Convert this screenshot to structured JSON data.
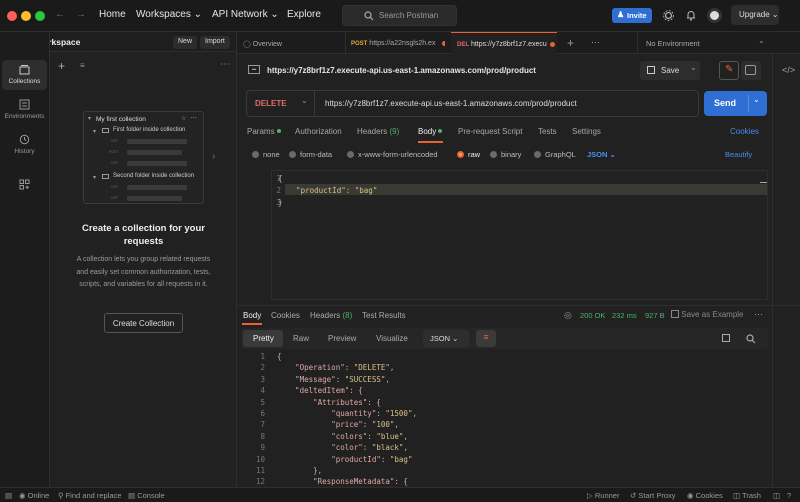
{
  "topbar": {
    "home": "Home",
    "workspaces": "Workspaces",
    "api_network": "API Network",
    "explore": "Explore",
    "search_placeholder": "Search Postman",
    "invite": "Invite",
    "upgrade": "Upgrade"
  },
  "workspace": {
    "name": "My Workspace",
    "new": "New",
    "import": "Import"
  },
  "rail": {
    "items": [
      "Collections",
      "Environments",
      "History"
    ]
  },
  "collections_empty": {
    "preview_title": "My first collection",
    "folder1": "First folder inside collection",
    "folder2": "Second folder inside collection",
    "methods": [
      "GET",
      "POST",
      "GET",
      "GET",
      "GET"
    ],
    "heading": "Create a collection for your requests",
    "body": "A collection lets you group related requests and easily set common authorization, tests, scripts, and variables for all requests in it.",
    "button": "Create Collection"
  },
  "tabs": [
    {
      "label": "Overview"
    },
    {
      "method": "POST",
      "label": "https://a22nsgls2h.ex"
    },
    {
      "method": "DEL",
      "label": "https://y7z8brf1z7.execu"
    }
  ],
  "environment": "No Environment",
  "request": {
    "title": "https://y7z8brf1z7.execute-api.us-east-1.amazonaws.com/prod/product",
    "save": "Save",
    "method": "DELETE",
    "url": "https://y7z8brf1z7.execute-api.us-east-1.amazonaws.com/prod/product",
    "send": "Send",
    "tabs": [
      "Params",
      "Authorization",
      "Headers",
      "Body",
      "Pre-request Script",
      "Tests",
      "Settings"
    ],
    "headers_count": "(9)",
    "cookies": "Cookies",
    "body_types": [
      "none",
      "form-data",
      "x-www-form-urlencoded",
      "raw",
      "binary",
      "GraphQL"
    ],
    "body_format": "JSON",
    "beautify": "Beautify",
    "body_lines": [
      "{",
      "    \"productId\": \"bag\"",
      "}"
    ]
  },
  "response": {
    "tabs": [
      "Body",
      "Cookies",
      "Headers",
      "Test Results"
    ],
    "headers_count": "(8)",
    "status": "200 OK",
    "time": "232 ms",
    "size": "927 B",
    "save_example": "Save as Example",
    "views": [
      "Pretty",
      "Raw",
      "Preview",
      "Visualize"
    ],
    "format": "JSON",
    "lines": [
      "{",
      "    \"Operation\": \"DELETE\",",
      "    \"Message\": \"SUCCESS\",",
      "    \"deltedItem\": {",
      "        \"Attributes\": {",
      "            \"quantity\": \"1500\",",
      "            \"price\": \"100\",",
      "            \"colors\": \"blue\",",
      "            \"color\": \"black\",",
      "            \"productId\": \"bag\"",
      "        },",
      "        \"ResponseMetadata\": {"
    ]
  },
  "statusbar": {
    "online": "Online",
    "find": "Find and replace",
    "console": "Console",
    "runner": "Runner",
    "proxy": "Start Proxy",
    "cookies": "Cookies",
    "trash": "Trash"
  },
  "colors": {
    "accent": "#2f6ed3",
    "delete_method": "#e06c6c",
    "post_method": "#e8a23a",
    "status_ok": "#4fb06d",
    "body_tab_underline": "#e8642c"
  }
}
